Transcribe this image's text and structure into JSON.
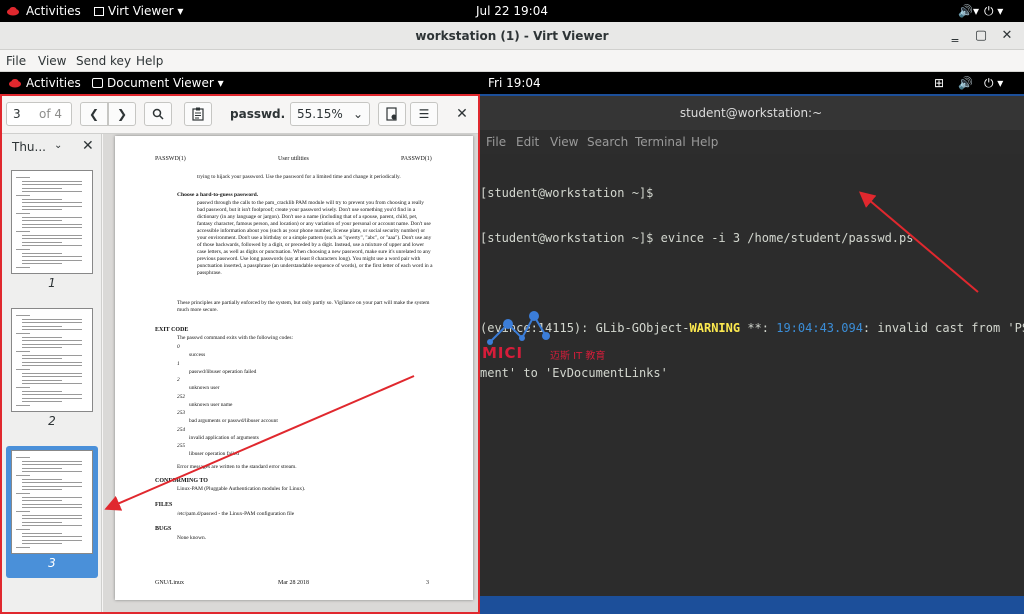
{
  "host": {
    "activities": "Activities",
    "app_menu": "Virt Viewer",
    "clock": "Jul 22  19:04"
  },
  "virt_viewer": {
    "title": "workstation (1) - Virt Viewer",
    "menu": [
      "File",
      "View",
      "Send key",
      "Help"
    ]
  },
  "guest": {
    "activities": "Activities",
    "app_menu": "Document Viewer",
    "clock": "Fri 19:04"
  },
  "terminal": {
    "title": "student@workstation:~",
    "menu": [
      "File",
      "Edit",
      "View",
      "Search",
      "Terminal",
      "Help"
    ],
    "line1": "[student@workstation ~]$",
    "line2": "[student@workstation ~]$ evince -i 3 /home/student/passwd.ps",
    "line4_pre": "(evince:14115): GLib-GObject-",
    "line4_warn": "WARNING",
    "line4_mid": " **: ",
    "line4_ts": "19:04:43.094",
    "line4_post": ": invalid cast from 'PS",
    "line5": "ment' to 'EvDocumentLinks'"
  },
  "docviewer": {
    "page_value": "3",
    "page_of": "of 4",
    "doc_name": "passwd.ps",
    "zoom": "55.15%",
    "sidebar_label": "Thu...",
    "thumbnails": [
      {
        "num": "1",
        "selected": false
      },
      {
        "num": "2",
        "selected": false
      },
      {
        "num": "3",
        "selected": true
      }
    ]
  },
  "page": {
    "hdr_left": "PASSWD(1)",
    "hdr_center": "User utilities",
    "hdr_right": "PASSWD(1)",
    "intro": "trying to hijack your password. Use the password for a limited time and change it periodically.",
    "choose_title": "Choose a hard-to-guess password.",
    "choose_body": "passwd through the calls to the pam_cracklib PAM module will try to prevent you from choosing a really bad password, but it isn't foolproof; create your password wisely. Don't use something you'd find in a dictionary (in any language or jargon). Don't use a name (including that of a spouse, parent, child, pet, fantasy character, famous person, and location) or any variation of your personal or account name. Don't use accessible information about you (such as your phone number, license plate, or social security number) or your environment. Don't use a birthday or a simple pattern (such as \"qwerty\", \"abc\", or \"aaa\"). Don't use any of those backwards, followed by a digit, or preceded by a digit. Instead, use a mixture of upper and lower case letters, as well as digits or punctuation. When choosing a new password, make sure it's unrelated to any previous password. Use long passwords (say at least 8 characters long). You might use a word pair with punctuation inserted, a passphrase (an understandable sequence of words), or the first letter of each word in a passphrase.",
    "principles": "These principles are partially enforced by the system, but only partly so. Vigilance on your part will make the system much more secure.",
    "exit_code": "EXIT CODE",
    "exit_intro": "The passwd command exits with the following codes:",
    "codes": [
      {
        "code": "0",
        "desc": "success"
      },
      {
        "code": "1",
        "desc": "passwd/libuser operation failed"
      },
      {
        "code": "2",
        "desc": "unknown user"
      },
      {
        "code": "252",
        "desc": "unknown user name"
      },
      {
        "code": "253",
        "desc": "bad arguments or passwd/libuser account"
      },
      {
        "code": "254",
        "desc": "invalid application of arguments"
      },
      {
        "code": "255",
        "desc": "libuser operation failed"
      }
    ],
    "error_note": "Error messages are written to the standard error stream.",
    "conforming": "CONFORMING TO",
    "conforming_body": "Linux-PAM (Pluggable Authentication modules for Linux).",
    "files": "FILES",
    "files_body": "/etc/pam.d/passwd - the Linux-PAM configuration file",
    "bugs": "BUGS",
    "bugs_body": "None known.",
    "ftr_left": "GNU/Linux",
    "ftr_center": "Mar 28 2018",
    "ftr_right": "3"
  },
  "logo": {
    "text": "MICI",
    "sub": "迈斯 IT 教育"
  },
  "colors": {
    "annotation_red": "#e0282e",
    "selection_blue": "#4a90d9",
    "desktop_blue": "#1c4f9a"
  }
}
